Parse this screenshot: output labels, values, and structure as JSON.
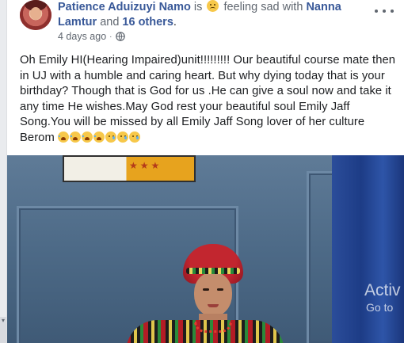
{
  "post": {
    "author": "Patience Aduizuyi Namo",
    "is_text": "is",
    "feeling_text": "feeling sad with",
    "tagged_person": "Nanna Lamtur",
    "and_text": "and",
    "others": "16 others",
    "period": ".",
    "timestamp": "4 days ago",
    "audience_icon": "globe-icon",
    "more_icon": "more-options-icon",
    "body": "Oh Emily HI(Hearing Impaired)unit!!!!!!!!!  Our beautiful course mate then in UJ with a humble and caring heart. But why dying today that is your birthday? Though that is God for us .He can give a soul now and take it any time He wishes.May God rest your beautiful soul Emily Jaff Song.You will be missed by all Emily Jaff Song lover of her culture Berom",
    "emojis": [
      "loudly-crying-face",
      "loudly-crying-face",
      "loudly-crying-face",
      "loudly-crying-face",
      "sad-tear-face",
      "sad-tear-face",
      "sad-tear-face"
    ]
  },
  "overlay": {
    "activate_title": "Activ",
    "activate_sub": "Go to"
  },
  "colors": {
    "link_blue": "#385898",
    "text": "#1c1e21",
    "meta_gray": "#606770"
  }
}
